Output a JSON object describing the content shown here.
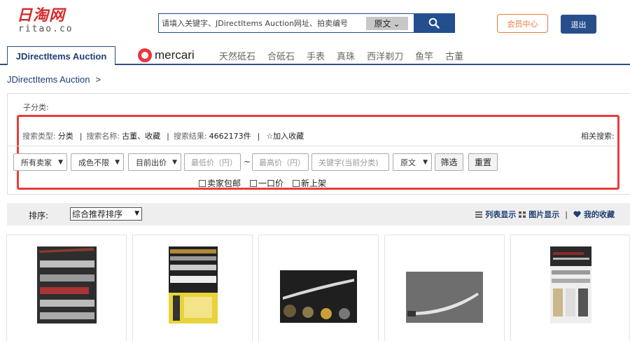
{
  "header": {
    "logo_main": "日淘网",
    "logo_sub": "ritao.co",
    "search_placeholder": "请填入关键字、JDirectItems Auction网址、拍卖编号",
    "lang": "原文",
    "member_label": "会员中心",
    "logout_label": "退出"
  },
  "nav": {
    "jd_label": "JDirectItems Auction",
    "mercari_label": "mercari",
    "items": [
      "天然砥石",
      "合砥石",
      "手表",
      "真珠",
      "西洋剃刀",
      "鱼竿",
      "古董"
    ]
  },
  "breadcrumb": {
    "root": "JDirectItems Auction",
    "sep": ">"
  },
  "filters": {
    "subcat_label": "子分类:",
    "search_type_label": "搜索类型:",
    "search_type_value": "分类",
    "search_name_label": "搜索名称:",
    "search_name_value": "古董、收藏",
    "result_label": "搜索结果:",
    "result_value": "4662173件",
    "favorite_label": "☆加入收藏",
    "related_label": "相关搜索:",
    "sellers": "所有卖家",
    "condition": "成色不限",
    "price_type": "目前出价",
    "min_price": "最低价（円）",
    "tilde": "~",
    "max_price": "最高价（円）",
    "keyword": "关键字(当前分类)",
    "lang": "原文",
    "filter_btn": "筛选",
    "reset_btn": "重置",
    "check_free_ship": "卖家包邮",
    "check_buy_now": "一口价",
    "check_new": "新上架"
  },
  "sort": {
    "label": "排序:",
    "value": "综合推荐排序",
    "list_view": "列表显示",
    "image_view": "图片显示",
    "favorites": "我的收藏"
  },
  "colors": {
    "accent": "#234f8f",
    "highlight_box": "#e83c3c",
    "member": "#e8793a"
  }
}
